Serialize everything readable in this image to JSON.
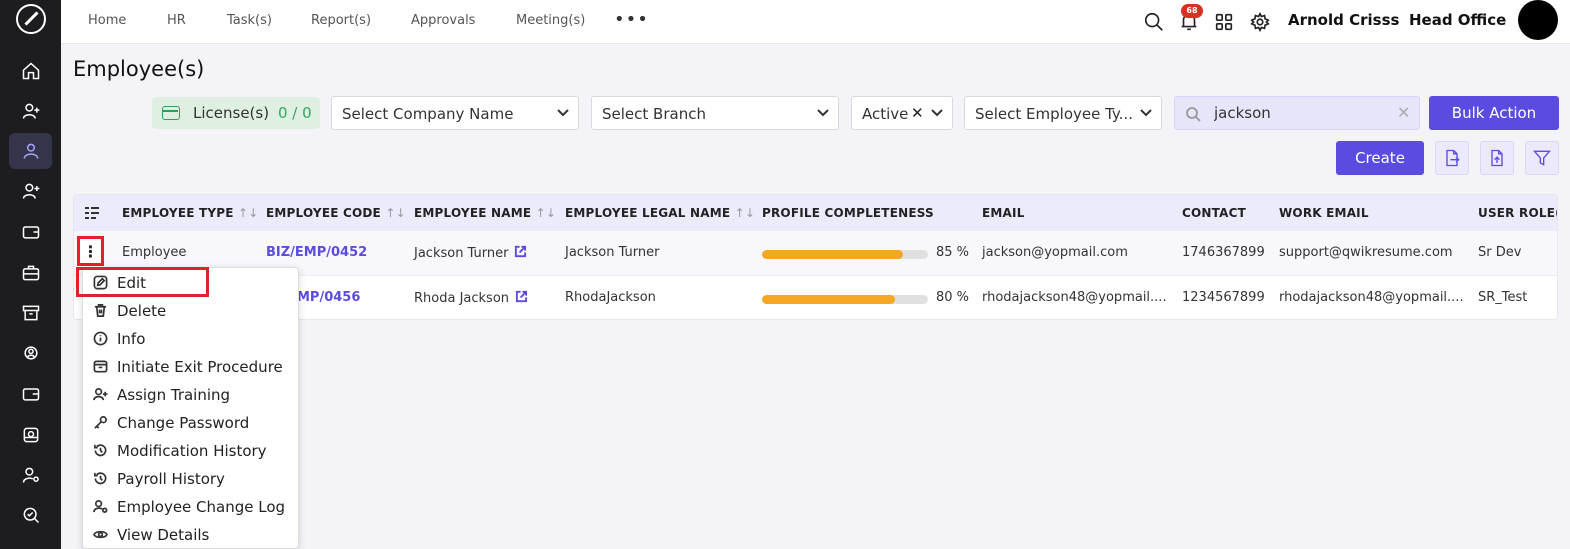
{
  "nav": {
    "items": [
      "Home",
      "HR",
      "Task(s)",
      "Report(s)",
      "Approvals",
      "Meeting(s)"
    ],
    "more": "•••",
    "notification_count": "68",
    "user_name": "Arnold Crisss",
    "office": "Head Office"
  },
  "sidebar": {
    "icons": [
      "home-icon",
      "user-plus-icon",
      "user-icon",
      "user-add-icon",
      "wallet-icon",
      "briefcase-icon",
      "archive-icon",
      "gear-user-icon",
      "card-icon",
      "inbox-icon",
      "user-settings-icon",
      "search-check-icon"
    ],
    "active_index": 2
  },
  "page": {
    "title": "Employee(s)"
  },
  "license": {
    "label": "License(s)",
    "count": "0 / 0"
  },
  "filters": {
    "company": "Select Company Name",
    "branch": "Select Branch",
    "status": "Active",
    "status_clear": "✕",
    "employee_type": "Select Employee Ty..."
  },
  "search": {
    "value": "jackson",
    "clear": "✕"
  },
  "buttons": {
    "bulk_action": "Bulk Action",
    "create": "Create"
  },
  "table": {
    "headers": [
      "EMPLOYEE TYPE",
      "EMPLOYEE CODE",
      "EMPLOYEE NAME",
      "EMPLOYEE LEGAL NAME",
      "PROFILE COMPLETENESS",
      "EMAIL",
      "CONTACT",
      "WORK EMAIL",
      "USER ROLE("
    ],
    "sort_glyph": "↑↓",
    "rows": [
      {
        "type": "Employee",
        "code": "BIZ/EMP/0452",
        "name": "Jackson Turner",
        "legal_name": "Jackson Turner",
        "completeness": 85,
        "completeness_label": "85 %",
        "email": "jackson@yopmail.com",
        "contact": "1746367899",
        "work_email": "support@qwikresume.com",
        "role": "Sr Dev"
      },
      {
        "type": "",
        "code": "MP/0456",
        "name": "Rhoda Jackson",
        "legal_name": "RhodaJackson",
        "completeness": 80,
        "completeness_label": "80 %",
        "email": "rhodajackson48@yopmail....",
        "contact": "1234567899",
        "work_email": "rhodajackson48@yopmail....",
        "role": "SR_Test"
      }
    ]
  },
  "row_menu": {
    "trigger": "⋮",
    "items": [
      "Edit",
      "Delete",
      "Info",
      "Initiate Exit Procedure",
      "Assign Training",
      "Change Password",
      "Modification History",
      "Payroll History",
      "Employee Change Log",
      "View Details"
    ]
  }
}
